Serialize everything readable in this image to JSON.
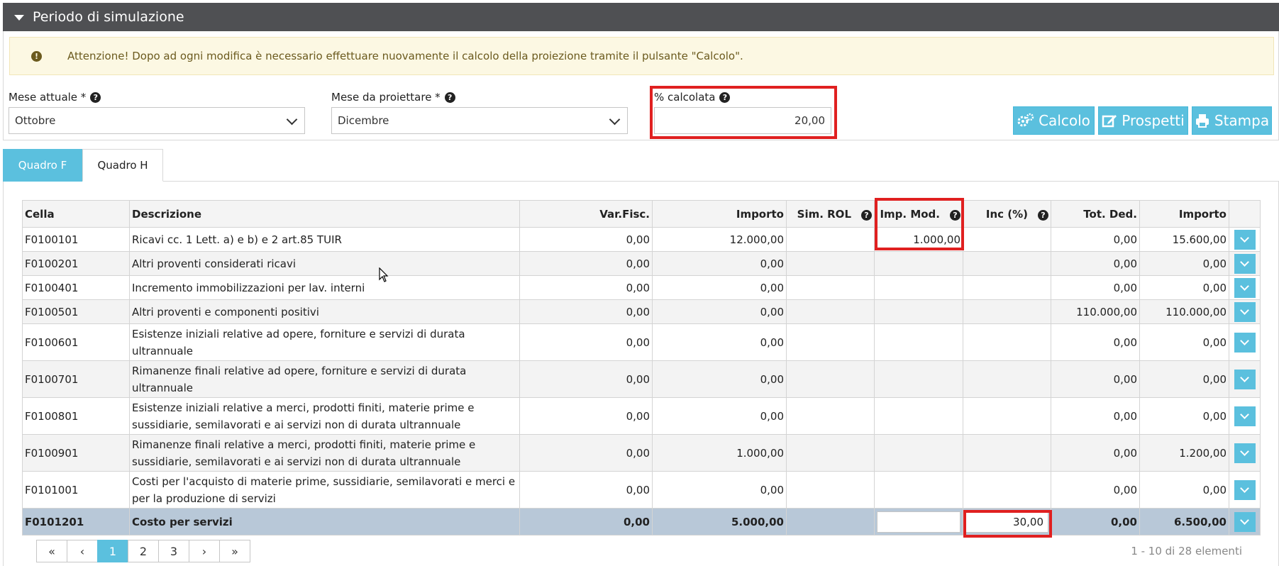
{
  "panel": {
    "title": "Periodo di simulazione"
  },
  "alert": {
    "text": "Attenzione! Dopo ad ogni modifica è necessario effettuare nuovamente il calcolo della proiezione tramite il pulsante \"Calcolo\"."
  },
  "form": {
    "mese_attuale": {
      "label": "Mese attuale *",
      "value": "Ottobre"
    },
    "mese_proiettare": {
      "label": "Mese da proiettare *",
      "value": "Dicembre"
    },
    "percentuale": {
      "label": "% calcolata",
      "value": "20,00"
    }
  },
  "toolbar": {
    "calcolo": "Calcolo",
    "prospetti": "Prospetti",
    "stampa": "Stampa"
  },
  "tabs": [
    "Quadro F",
    "Quadro H"
  ],
  "table": {
    "headers": [
      "Cella",
      "Descrizione",
      "Var.Fisc.",
      "Importo",
      "Sim. ROL",
      "Imp. Mod.",
      "Inc (%)",
      "Tot. Ded.",
      "Importo"
    ],
    "rows": [
      {
        "cella": "F0100101",
        "descrizione": "Ricavi cc. 1 Lett. a) e b) e 2 art.85 TUIR",
        "var_fisc": "0,00",
        "importo": "12.000,00",
        "sim_rol": "",
        "imp_mod": "1.000,00",
        "inc": "",
        "tot_ded": "0,00",
        "importo2": "15.600,00"
      },
      {
        "cella": "F0100201",
        "descrizione": "Altri proventi considerati ricavi",
        "var_fisc": "0,00",
        "importo": "0,00",
        "sim_rol": "",
        "imp_mod": "",
        "inc": "",
        "tot_ded": "0,00",
        "importo2": "0,00"
      },
      {
        "cella": "F0100401",
        "descrizione": "Incremento immobilizzazioni per lav. interni",
        "var_fisc": "0,00",
        "importo": "0,00",
        "sim_rol": "",
        "imp_mod": "",
        "inc": "",
        "tot_ded": "0,00",
        "importo2": "0,00"
      },
      {
        "cella": "F0100501",
        "descrizione": "Altri proventi e componenti positivi",
        "var_fisc": "0,00",
        "importo": "0,00",
        "sim_rol": "",
        "imp_mod": "",
        "inc": "",
        "tot_ded": "110.000,00",
        "importo2": "110.000,00"
      },
      {
        "cella": "F0100601",
        "descrizione": "Esistenze iniziali relative ad opere, forniture e servizi di durata ultrannuale",
        "var_fisc": "0,00",
        "importo": "0,00",
        "sim_rol": "",
        "imp_mod": "",
        "inc": "",
        "tot_ded": "0,00",
        "importo2": "0,00"
      },
      {
        "cella": "F0100701",
        "descrizione": "Rimanenze finali relative ad opere, forniture e servizi di durata ultrannuale",
        "var_fisc": "0,00",
        "importo": "0,00",
        "sim_rol": "",
        "imp_mod": "",
        "inc": "",
        "tot_ded": "0,00",
        "importo2": "0,00"
      },
      {
        "cella": "F0100801",
        "descrizione": "Esistenze iniziali relative a merci, prodotti finiti, materie prime e sussidiarie, semilavorati e ai servizi non di durata ultrannuale",
        "var_fisc": "0,00",
        "importo": "0,00",
        "sim_rol": "",
        "imp_mod": "",
        "inc": "",
        "tot_ded": "0,00",
        "importo2": "0,00"
      },
      {
        "cella": "F0100901",
        "descrizione": "Rimanenze finali relative a merci, prodotti finiti, materie prime e sussidiarie, semilavorati e ai servizi non di durata ultrannuale",
        "var_fisc": "0,00",
        "importo": "1.000,00",
        "sim_rol": "",
        "imp_mod": "",
        "inc": "",
        "tot_ded": "0,00",
        "importo2": "1.200,00"
      },
      {
        "cella": "F0101001",
        "descrizione": "Costi per l'acquisto di materie prime, sussidiarie, semilavorati e merci e per la produzione di servizi",
        "var_fisc": "0,00",
        "importo": "0,00",
        "sim_rol": "",
        "imp_mod": "",
        "inc": "",
        "tot_ded": "0,00",
        "importo2": "0,00"
      },
      {
        "cella": "F0101201",
        "descrizione": "Costo per servizi",
        "var_fisc": "0,00",
        "importo": "5.000,00",
        "sim_rol": "",
        "imp_mod": "",
        "inc": "30,00",
        "tot_ded": "0,00",
        "importo2": "6.500,00"
      }
    ]
  },
  "pager": {
    "first": "«",
    "prev": "‹",
    "pages": [
      "1",
      "2",
      "3"
    ],
    "next": "›",
    "last": "»",
    "info": "1 - 10 di 28 elementi"
  }
}
